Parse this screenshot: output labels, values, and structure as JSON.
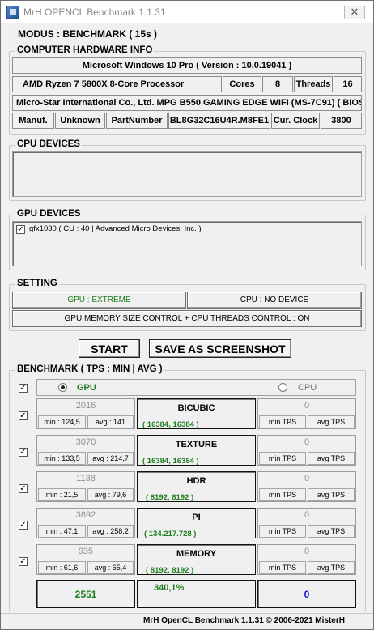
{
  "window": {
    "title": "MrH OPENCL Benchmark 1.1.31",
    "close_glyph": "✕"
  },
  "mode": "MODUS : BENCHMARK ( 15s )",
  "hardware": {
    "section_label": "COMPUTER HARDWARE INFO",
    "os": "Microsoft Windows 10 Pro ( Version : 10.0.19041 )",
    "cpu_name": "AMD Ryzen 7 5800X 8-Core Processor",
    "cores_label": "Cores",
    "cores_value": "8",
    "threads_label": "Threads",
    "threads_value": "16",
    "board": "Micro-Star International Co., Ltd. MPG B550 GAMING EDGE WIFI (MS-7C91) ( BIOS",
    "manuf_label": "Manuf.",
    "manuf_value": "Unknown",
    "part_label": "PartNumber",
    "part_value": "BL8G32C16U4R.M8FE1",
    "clock_label": "Cur. Clock",
    "clock_value": "3800"
  },
  "cpu_devices": {
    "section_label": "CPU DEVICES"
  },
  "gpu_devices": {
    "section_label": "GPU DEVICES",
    "items": [
      {
        "checked": "✓",
        "label": "gfx1030 ( CU : 40 | Advanced Micro Devices, Inc. )"
      }
    ]
  },
  "setting": {
    "section_label": "SETTING",
    "gpu_button": "GPU : EXTREME",
    "cpu_button": "CPU : NO DEVICE",
    "memory_button": "GPU MEMORY SIZE CONTROL + CPU THREADS CONTROL : ON"
  },
  "actions": {
    "start": "START",
    "screenshot": "SAVE AS SCREENSHOT"
  },
  "benchmark": {
    "section_label": "BENCHMARK ( TPS : MIN | AVG )",
    "check_glyph": "✓",
    "gpu_label": "GPU",
    "cpu_label": "CPU",
    "rows": [
      {
        "gpu_score": "2016",
        "gpu_min": "min : 124,5",
        "gpu_avg": "avg : 141",
        "name": "BICUBIC",
        "sub": "( 16384, 16384 )",
        "cpu_score": "0",
        "cpu_min": "min TPS",
        "cpu_avg": "avg TPS"
      },
      {
        "gpu_score": "3070",
        "gpu_min": "min : 133,5",
        "gpu_avg": "avg : 214,7",
        "name": "TEXTURE",
        "sub": "( 16384, 16384 )",
        "cpu_score": "0",
        "cpu_min": "min TPS",
        "cpu_avg": "avg TPS"
      },
      {
        "gpu_score": "1138",
        "gpu_min": "min : 21,5",
        "gpu_avg": "avg : 79,6",
        "name": "HDR",
        "sub": "( 8192, 8192 )",
        "cpu_score": "0",
        "cpu_min": "min TPS",
        "cpu_avg": "avg TPS"
      },
      {
        "gpu_score": "3692",
        "gpu_min": "min : 47,1",
        "gpu_avg": "avg : 258,2",
        "name": "PI",
        "sub": "( 134.217.728 )",
        "cpu_score": "0",
        "cpu_min": "min TPS",
        "cpu_avg": "avg TPS"
      },
      {
        "gpu_score": "935",
        "gpu_min": "min : 61,6",
        "gpu_avg": "avg : 65,4",
        "name": "MEMORY",
        "sub": "( 8192, 8192 )",
        "cpu_score": "0",
        "cpu_min": "min TPS",
        "cpu_avg": "avg TPS"
      }
    ],
    "totals": {
      "gpu_total": "2551",
      "ratio": "340,1%",
      "cpu_total": "0"
    }
  },
  "footer": "MrH OpenCL Benchmark 1.1.31  ©  2006-2021 MisterH"
}
